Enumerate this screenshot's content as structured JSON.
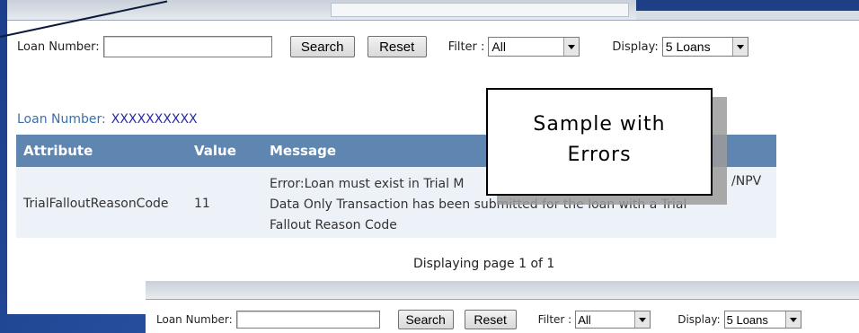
{
  "search_bar": {
    "loan_label": "Loan Number:",
    "loan_value": "",
    "search_label": "Search",
    "reset_label": "Reset",
    "filter_label": "Filter :",
    "filter_value": "All",
    "display_label": "Display:",
    "display_value": "5 Loans"
  },
  "result": {
    "loan_label": "Loan Number:",
    "loan_value": "XXXXXXXXXX",
    "headers": [
      "Attribute",
      "Value",
      "Message"
    ],
    "row": {
      "attribute": "TrialFalloutReasonCode",
      "value": "11",
      "message_lines": [
        "Error:Loan must exist in Trial M",
        "/NPV",
        "Data Only Transaction has been submitted for the loan with a Trial",
        "Fallout Reason Code"
      ]
    },
    "pager": "Displaying page 1 of 1"
  },
  "callout": {
    "lines": [
      "Sample with",
      "Errors"
    ]
  },
  "bottom_search_bar": {
    "loan_label": "Loan Number:",
    "search_label": "Search",
    "reset_label": "Reset",
    "filter_label": "Filter :",
    "filter_value": "All",
    "display_label": "Display:",
    "display_value": "5 Loans"
  }
}
